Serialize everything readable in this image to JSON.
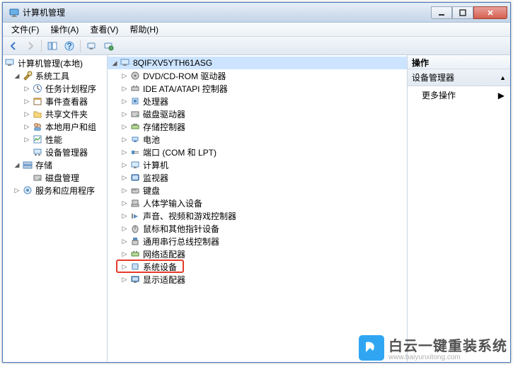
{
  "window": {
    "title": "计算机管理"
  },
  "menubar": [
    {
      "label": "文件(F)"
    },
    {
      "label": "操作(A)"
    },
    {
      "label": "查看(V)"
    },
    {
      "label": "帮助(H)"
    }
  ],
  "left_tree": {
    "root": "计算机管理(本地)",
    "groups": [
      {
        "label": "系统工具",
        "children": [
          "任务计划程序",
          "事件查看器",
          "共享文件夹",
          "本地用户和组",
          "性能",
          "设备管理器"
        ]
      },
      {
        "label": "存储",
        "children": [
          "磁盘管理"
        ]
      },
      {
        "label": "服务和应用程序",
        "children": []
      }
    ]
  },
  "device_tree": {
    "root": "8QIFXV5YTH61ASG",
    "items": [
      "DVD/CD-ROM 驱动器",
      "IDE ATA/ATAPI 控制器",
      "处理器",
      "磁盘驱动器",
      "存储控制器",
      "电池",
      "端口 (COM 和 LPT)",
      "计算机",
      "监视器",
      "键盘",
      "人体学输入设备",
      "声音、视频和游戏控制器",
      "鼠标和其他指针设备",
      "通用串行总线控制器",
      "网络适配器",
      "系统设备",
      "显示适配器"
    ],
    "highlighted_index": 16
  },
  "actions_pane": {
    "header": "操作",
    "section_title": "设备管理器",
    "more_actions": "更多操作"
  },
  "watermark": {
    "cn": "白云一键重装系统",
    "en": "www.baiyunxitong.com"
  }
}
